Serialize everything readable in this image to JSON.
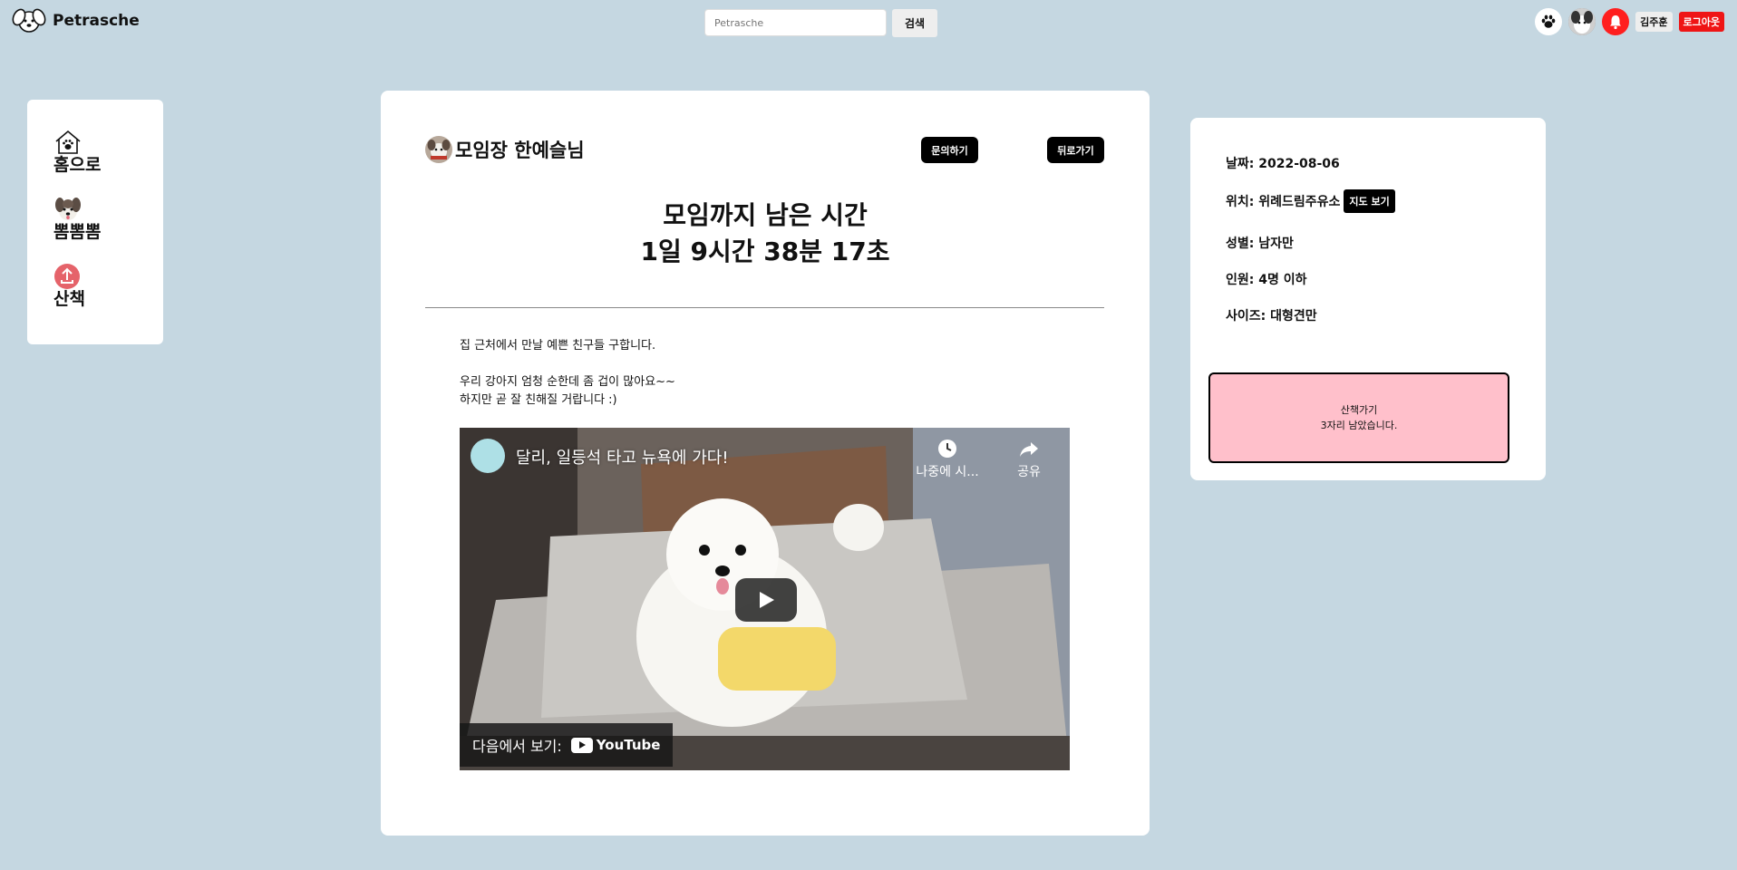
{
  "header": {
    "logo_text": "Petrasche",
    "search_placeholder": "Petrasche",
    "search_button": "검색",
    "user_name": "김주훈",
    "logout_button": "로그아웃"
  },
  "sidebar": {
    "items": [
      {
        "label": "홈으로",
        "icon": "home-paw-icon"
      },
      {
        "label": "뽐뽐뽐",
        "icon": "dog-face-icon"
      },
      {
        "label": "산책",
        "icon": "upload-icon"
      }
    ]
  },
  "main": {
    "host_name": "모임장 한예슬님",
    "inquire_button": "문의하기",
    "back_button": "뒤로가기",
    "countdown_title": "모임까지 남은 시간",
    "countdown_time": "1일 9시간 38분 17초",
    "description": [
      "집 근처에서 만날 예쁜 친구들 구합니다.",
      "",
      "우리 강아지 엄청 순한데 좀 겁이 많아요~~",
      "하지만 곧 잘 친해질 거랍니다 :)"
    ],
    "video": {
      "title": "달리, 일등석 타고 뉴욕에 가다!",
      "watch_later": "나중에 시...",
      "share": "공유",
      "watch_on": "다음에서 보기:",
      "platform": "YouTube"
    }
  },
  "info": {
    "date": "날짜: 2022-08-06",
    "location": "위치: 위례드림주유소",
    "map_button": "지도 보기",
    "gender": "성별: 남자만",
    "capacity": "인원: 4명 이하",
    "size": "사이즈: 대형견만",
    "walk_title": "산책가기",
    "walk_remaining": "3자리 남았습니다."
  },
  "colors": {
    "background": "#c5d7e1",
    "walk_box": "#ffc0cb",
    "bell": "#ff1f1f",
    "logout": "#ef1515"
  }
}
